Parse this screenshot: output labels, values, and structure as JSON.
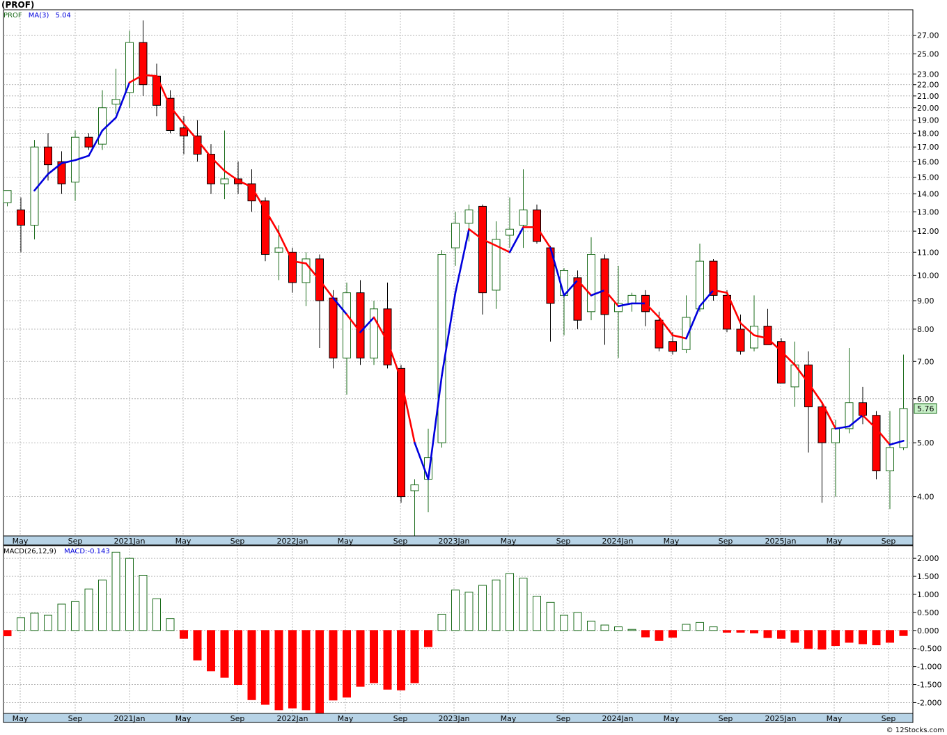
{
  "ticker_title": "(PROF)",
  "watermark": "© 12Stocks.com",
  "colors": {
    "up_outline": "#1a6b1a",
    "down_fill": "#ff0000",
    "ma_up": "#0000dd",
    "ma_down": "#ff0000",
    "grid": "#a8a8a8",
    "axis_band": "#b7d3e6",
    "macd_pos": "#1a6b1a",
    "macd_neg": "#ff0000",
    "last_price_box": "#c8f0c8"
  },
  "chart_data": [
    {
      "type": "candlestick",
      "symbol": "PROF",
      "ma_label": "MA(3)",
      "ma_value": "5.04",
      "last_price": "5.76",
      "scale": "log",
      "ylim": [
        3.4,
        30
      ],
      "y_ticks": [
        "27.00",
        "25.00",
        "23.00",
        "22.00",
        "21.00",
        "20.00",
        "19.00",
        "18.00",
        "17.00",
        "16.00",
        "15.00",
        "14.00",
        "13.00",
        "12.00",
        "11.00",
        "10.00",
        "9.00",
        "8.00",
        "7.00",
        "6.00",
        "5.00",
        "4.00"
      ],
      "x_labels": [
        "May",
        "Sep",
        "2021Jan",
        "May",
        "Sep",
        "2022Jan",
        "May",
        "Sep",
        "2023Jan",
        "May",
        "Sep",
        "2024Jan",
        "May",
        "Sep",
        "2025Jan",
        "May",
        "Sep"
      ],
      "candles": [
        {
          "o": 13.5,
          "h": 14.2,
          "l": 13.3,
          "c": 14.2
        },
        {
          "o": 13.1,
          "h": 13.8,
          "l": 11.0,
          "c": 12.3
        },
        {
          "o": 12.3,
          "h": 17.5,
          "l": 11.6,
          "c": 17.0
        },
        {
          "o": 17.0,
          "h": 18.0,
          "l": 14.8,
          "c": 15.8
        },
        {
          "o": 16.0,
          "h": 16.7,
          "l": 14.0,
          "c": 14.6
        },
        {
          "o": 14.7,
          "h": 18.2,
          "l": 13.6,
          "c": 17.7
        },
        {
          "o": 17.7,
          "h": 18.0,
          "l": 16.8,
          "c": 17.0
        },
        {
          "o": 17.2,
          "h": 21.5,
          "l": 16.8,
          "c": 20.0
        },
        {
          "o": 20.3,
          "h": 23.5,
          "l": 19.5,
          "c": 20.7
        },
        {
          "o": 21.3,
          "h": 27.5,
          "l": 20.0,
          "c": 26.2
        },
        {
          "o": 26.2,
          "h": 28.7,
          "l": 21.0,
          "c": 22.0
        },
        {
          "o": 22.8,
          "h": 24.0,
          "l": 19.3,
          "c": 20.2
        },
        {
          "o": 20.8,
          "h": 21.5,
          "l": 18.0,
          "c": 18.2
        },
        {
          "o": 18.4,
          "h": 19.3,
          "l": 16.5,
          "c": 17.8
        },
        {
          "o": 17.8,
          "h": 19.0,
          "l": 16.0,
          "c": 16.5
        },
        {
          "o": 16.5,
          "h": 17.2,
          "l": 14.0,
          "c": 14.6
        },
        {
          "o": 14.6,
          "h": 18.2,
          "l": 13.7,
          "c": 14.9
        },
        {
          "o": 14.9,
          "h": 16.0,
          "l": 14.0,
          "c": 14.6
        },
        {
          "o": 14.6,
          "h": 15.5,
          "l": 13.0,
          "c": 13.6
        },
        {
          "o": 13.6,
          "h": 13.8,
          "l": 10.6,
          "c": 10.9
        },
        {
          "o": 11.0,
          "h": 12.3,
          "l": 9.8,
          "c": 11.2
        },
        {
          "o": 11.0,
          "h": 11.2,
          "l": 9.3,
          "c": 9.7
        },
        {
          "o": 9.7,
          "h": 11.0,
          "l": 8.8,
          "c": 10.7
        },
        {
          "o": 10.7,
          "h": 10.9,
          "l": 7.4,
          "c": 9.0
        },
        {
          "o": 9.1,
          "h": 9.4,
          "l": 6.8,
          "c": 7.1
        },
        {
          "o": 7.1,
          "h": 9.7,
          "l": 6.1,
          "c": 9.3
        },
        {
          "o": 9.3,
          "h": 9.8,
          "l": 6.9,
          "c": 7.1
        },
        {
          "o": 7.1,
          "h": 9.0,
          "l": 6.9,
          "c": 8.7
        },
        {
          "o": 8.7,
          "h": 9.7,
          "l": 6.8,
          "c": 6.9
        },
        {
          "o": 6.8,
          "h": 6.9,
          "l": 3.9,
          "c": 4.0
        },
        {
          "o": 4.1,
          "h": 4.3,
          "l": 3.4,
          "c": 4.2
        },
        {
          "o": 4.3,
          "h": 5.3,
          "l": 3.75,
          "c": 4.7
        },
        {
          "o": 5.0,
          "h": 11.1,
          "l": 4.9,
          "c": 10.9
        },
        {
          "o": 11.2,
          "h": 13.0,
          "l": 10.4,
          "c": 12.4
        },
        {
          "o": 12.4,
          "h": 13.4,
          "l": 11.5,
          "c": 13.1
        },
        {
          "o": 13.3,
          "h": 13.4,
          "l": 8.5,
          "c": 9.3
        },
        {
          "o": 9.4,
          "h": 12.5,
          "l": 8.7,
          "c": 11.6
        },
        {
          "o": 11.8,
          "h": 13.8,
          "l": 11.2,
          "c": 12.1
        },
        {
          "o": 12.3,
          "h": 15.5,
          "l": 11.2,
          "c": 13.1
        },
        {
          "o": 13.1,
          "h": 13.4,
          "l": 11.4,
          "c": 11.5
        },
        {
          "o": 11.2,
          "h": 11.3,
          "l": 7.6,
          "c": 8.9
        },
        {
          "o": 9.2,
          "h": 10.3,
          "l": 7.8,
          "c": 10.2
        },
        {
          "o": 9.9,
          "h": 10.2,
          "l": 8.0,
          "c": 8.3
        },
        {
          "o": 8.6,
          "h": 11.7,
          "l": 8.3,
          "c": 10.9
        },
        {
          "o": 10.7,
          "h": 10.9,
          "l": 7.5,
          "c": 8.5
        },
        {
          "o": 8.6,
          "h": 10.4,
          "l": 7.1,
          "c": 8.9
        },
        {
          "o": 8.9,
          "h": 9.3,
          "l": 8.6,
          "c": 9.2
        },
        {
          "o": 9.2,
          "h": 9.4,
          "l": 8.1,
          "c": 8.6
        },
        {
          "o": 8.3,
          "h": 8.6,
          "l": 7.3,
          "c": 7.4
        },
        {
          "o": 7.6,
          "h": 7.9,
          "l": 7.2,
          "c": 7.3
        },
        {
          "o": 7.35,
          "h": 9.2,
          "l": 7.25,
          "c": 8.4
        },
        {
          "o": 8.7,
          "h": 11.4,
          "l": 8.6,
          "c": 10.6
        },
        {
          "o": 10.6,
          "h": 10.7,
          "l": 9.0,
          "c": 9.2
        },
        {
          "o": 9.2,
          "h": 9.4,
          "l": 7.9,
          "c": 8.0
        },
        {
          "o": 8.0,
          "h": 8.5,
          "l": 7.2,
          "c": 7.3
        },
        {
          "o": 7.4,
          "h": 9.2,
          "l": 7.3,
          "c": 8.1
        },
        {
          "o": 8.1,
          "h": 8.7,
          "l": 7.5,
          "c": 7.5
        },
        {
          "o": 7.6,
          "h": 7.7,
          "l": 6.5,
          "c": 6.4
        },
        {
          "o": 6.3,
          "h": 7.6,
          "l": 5.8,
          "c": 6.9
        },
        {
          "o": 6.9,
          "h": 7.3,
          "l": 4.8,
          "c": 5.8
        },
        {
          "o": 5.8,
          "h": 5.9,
          "l": 3.9,
          "c": 5.0
        },
        {
          "o": 5.0,
          "h": 5.5,
          "l": 4.0,
          "c": 5.3
        },
        {
          "o": 5.3,
          "h": 7.4,
          "l": 5.2,
          "c": 5.9
        },
        {
          "o": 5.9,
          "h": 6.3,
          "l": 5.4,
          "c": 5.6
        },
        {
          "o": 5.6,
          "h": 5.7,
          "l": 4.3,
          "c": 4.45
        },
        {
          "o": 4.45,
          "h": 5.7,
          "l": 3.8,
          "c": 4.9
        },
        {
          "o": 4.9,
          "h": 7.2,
          "l": 4.85,
          "c": 5.76
        }
      ],
      "ma3": [
        null,
        null,
        14.2,
        15.2,
        15.9,
        16.1,
        16.4,
        18.2,
        19.2,
        22.2,
        22.9,
        22.8,
        20.1,
        18.7,
        17.5,
        16.3,
        15.4,
        14.8,
        14.4,
        13.1,
        11.9,
        10.6,
        10.5,
        9.8,
        9.1,
        8.5,
        7.9,
        8.4,
        7.6,
        6.5,
        5.0,
        4.3,
        6.6,
        9.3,
        12.1,
        11.6,
        11.3,
        11.0,
        12.2,
        12.2,
        11.2,
        9.2,
        9.8,
        9.2,
        9.4,
        8.8,
        8.9,
        8.9,
        8.4,
        7.8,
        7.7,
        8.8,
        9.4,
        9.3,
        8.2,
        7.8,
        7.7,
        7.3,
        6.9,
        6.4,
        5.9,
        5.3,
        5.35,
        5.6,
        5.3,
        4.96,
        5.04
      ],
      "ma_trend": [
        "",
        "",
        "u",
        "u",
        "u",
        "u",
        "u",
        "u",
        "u",
        "u",
        "d",
        "d",
        "d",
        "d",
        "d",
        "d",
        "d",
        "d",
        "d",
        "d",
        "d",
        "d",
        "d",
        "d",
        "d",
        "u",
        "d",
        "u",
        "d",
        "d",
        "d",
        "u",
        "u",
        "u",
        "u",
        "d",
        "d",
        "d",
        "u",
        "d",
        "d",
        "u",
        "u",
        "d",
        "u",
        "d",
        "u",
        "u",
        "d",
        "d",
        "d",
        "u",
        "u",
        "d",
        "d",
        "d",
        "d",
        "d",
        "d",
        "d",
        "d",
        "d",
        "u",
        "u",
        "d",
        "d",
        "u"
      ]
    },
    {
      "type": "bar",
      "label": "MACD(26,12,9)",
      "value_label": "MACD:-0.143",
      "ylim": [
        -2.3,
        2.35
      ],
      "y_ticks": [
        "2.000",
        "1.500",
        "1.000",
        "0.500",
        "0.000",
        "-0.500",
        "-1.000",
        "-1.500",
        "-2.000"
      ],
      "x_labels": [
        "May",
        "Sep",
        "2021Jan",
        "May",
        "Sep",
        "2022Jan",
        "May",
        "Sep",
        "2023Jan",
        "May",
        "Sep",
        "2024Jan",
        "May",
        "Sep",
        "2025Jan",
        "May",
        "Sep"
      ],
      "values": [
        -0.15,
        0.35,
        0.48,
        0.42,
        0.73,
        0.8,
        1.15,
        1.4,
        2.17,
        2.0,
        1.53,
        0.88,
        0.33,
        -0.22,
        -0.82,
        -1.12,
        -1.3,
        -1.5,
        -1.92,
        -2.05,
        -2.2,
        -2.15,
        -2.2,
        -2.5,
        -1.93,
        -1.85,
        -1.55,
        -1.45,
        -1.63,
        -1.65,
        -1.45,
        -0.45,
        0.45,
        1.12,
        1.06,
        1.25,
        1.4,
        1.58,
        1.45,
        0.95,
        0.78,
        0.42,
        0.5,
        0.26,
        0.15,
        0.1,
        0.03,
        -0.18,
        -0.28,
        -0.19,
        0.17,
        0.22,
        0.1,
        -0.05,
        -0.05,
        -0.07,
        -0.2,
        -0.22,
        -0.33,
        -0.5,
        -0.52,
        -0.42,
        -0.33,
        -0.37,
        -0.4,
        -0.33,
        -0.143
      ]
    }
  ]
}
